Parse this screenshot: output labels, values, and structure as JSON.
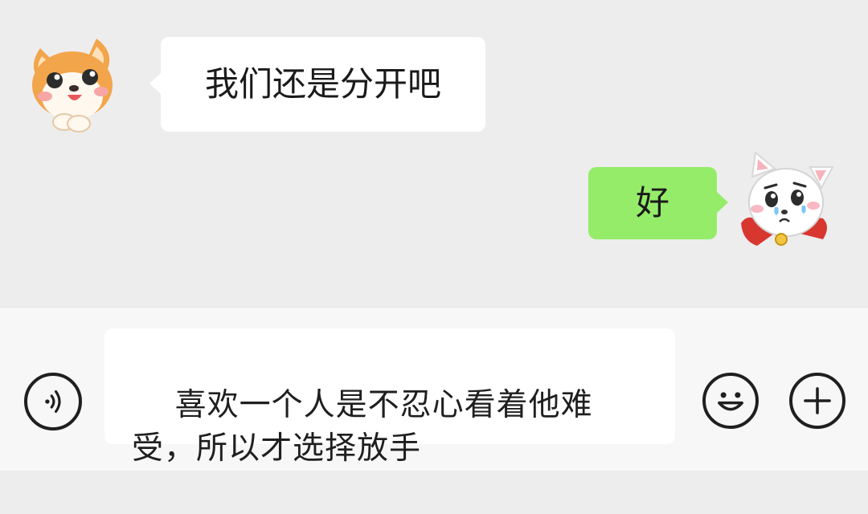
{
  "chat": {
    "messages": [
      {
        "side": "incoming",
        "avatar_icon": "shiba-dog-avatar-icon",
        "text": "我们还是分开吧"
      },
      {
        "side": "outgoing",
        "avatar_icon": "white-cat-avatar-icon",
        "text": "好"
      }
    ]
  },
  "input_bar": {
    "voice_icon": "voice-icon",
    "draft_text": "喜欢一个人是不忍心看着他难受，所以才选择放手",
    "emoji_icon": "smiley-face-icon",
    "more_icon": "plus-icon"
  },
  "colors": {
    "chat_background": "#ededed",
    "incoming_bubble": "#ffffff",
    "outgoing_bubble": "#95ec69",
    "input_bar_background": "#f7f7f7"
  }
}
